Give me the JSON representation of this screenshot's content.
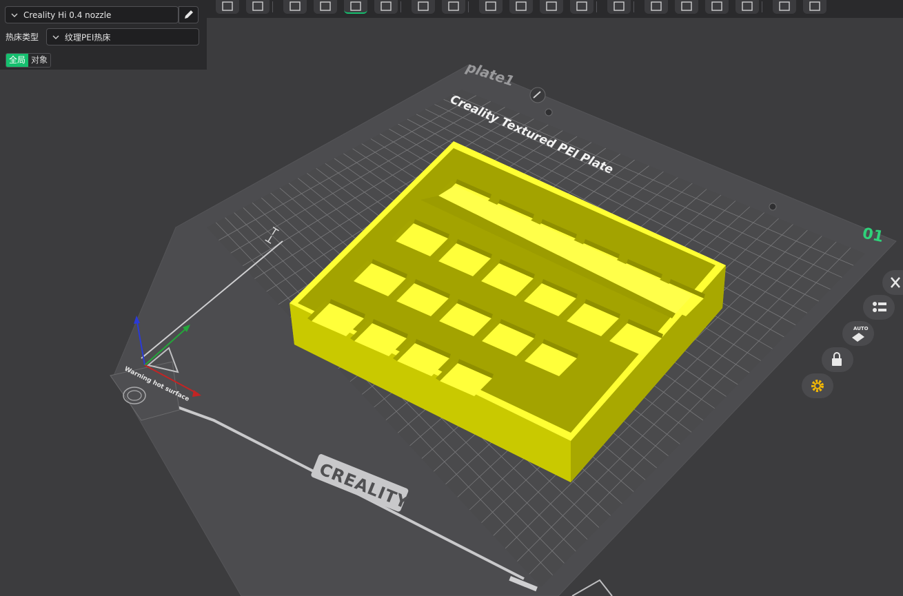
{
  "printer": {
    "selected": "Creality Hi 0.4 nozzle",
    "edit_icon": "pencil-icon"
  },
  "bed_type": {
    "label": "热床类型",
    "selected": "纹理PEI热床"
  },
  "scope_tabs": [
    {
      "label": "全局",
      "active": true
    },
    {
      "label": "对象",
      "active": false
    }
  ],
  "toolbar": {
    "icons": [
      "add-object-icon",
      "arrange-grid-icon",
      "orient-icon",
      "lay-on-face-icon",
      "paint-icon",
      "split-icon",
      "measure-icon",
      "assembly-icon",
      "support-paint-icon",
      "cut-icon",
      "mesh-boolean-icon",
      "hollow-icon",
      "seam-paint-icon",
      "fuzzy-skin-icon",
      "text-emboss-icon",
      "svg-emboss-icon",
      "variable-layer-icon",
      "brim-ears-icon",
      "settings-icon"
    ],
    "active_icon": "paint-icon"
  },
  "plate": {
    "name": "plate1",
    "number": "01",
    "bed_text": "Creality Textured PEI Plate",
    "brand": "CREALITY",
    "warning": "Warning hot surface"
  },
  "side_buttons": [
    "close-icon",
    "layers-icon",
    "auto-orient-icon",
    "lock-icon",
    "gear-icon"
  ],
  "side_auto_label": "AUTO",
  "colors": {
    "accent": "#15bf6e",
    "model": "#f2f200",
    "background": "#3c3c3e",
    "plate_number": "#2fd17a"
  }
}
